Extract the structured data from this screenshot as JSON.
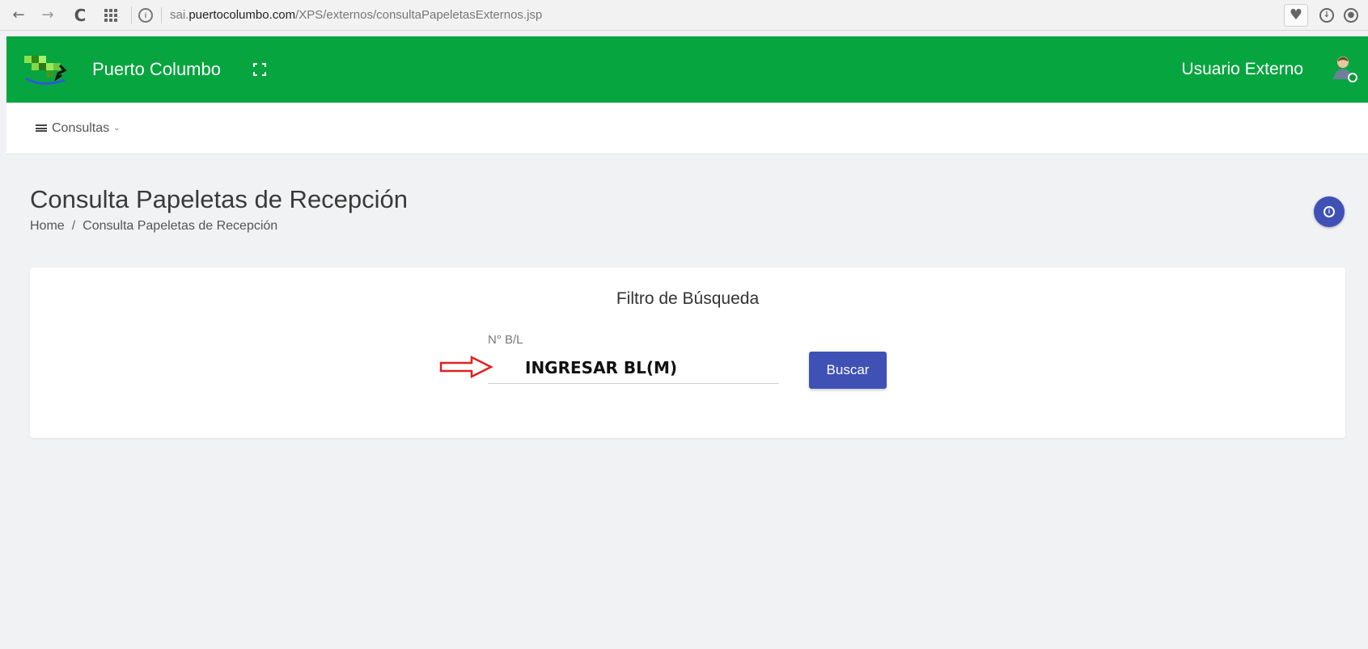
{
  "browser": {
    "url_domain_prefix": "sai.",
    "url_domain": "puertocolumbo.com",
    "url_path": "/XPS/externos/consultaPapeletasExternos.jsp",
    "back_icon": "←",
    "forward_icon": "→",
    "reload_icon": "C",
    "site_info_icon": "ⓘ",
    "heart_icon": "♥",
    "download_icon": "⬇",
    "account_icon": "👤"
  },
  "header": {
    "brand": "Puerto Columbo",
    "user_name": "Usuario Externo",
    "colors": {
      "bar": "#06a53f"
    }
  },
  "menu": {
    "items": [
      {
        "label": "Consultas",
        "chevron": "⌄"
      }
    ]
  },
  "page": {
    "title": "Consulta Papeletas de Recepción",
    "breadcrumb": {
      "home": "Home",
      "separator": "/",
      "current": "Consulta Papeletas de Recepción"
    },
    "info_icon": "i"
  },
  "filter": {
    "title": "Filtro de Búsqueda",
    "field_label": "N° B/L",
    "field_placeholder": "INGRESAR BL(M)",
    "button_label": "Buscar",
    "accent": "#3f51b5",
    "annotation_arrow_color": "#e02020"
  }
}
